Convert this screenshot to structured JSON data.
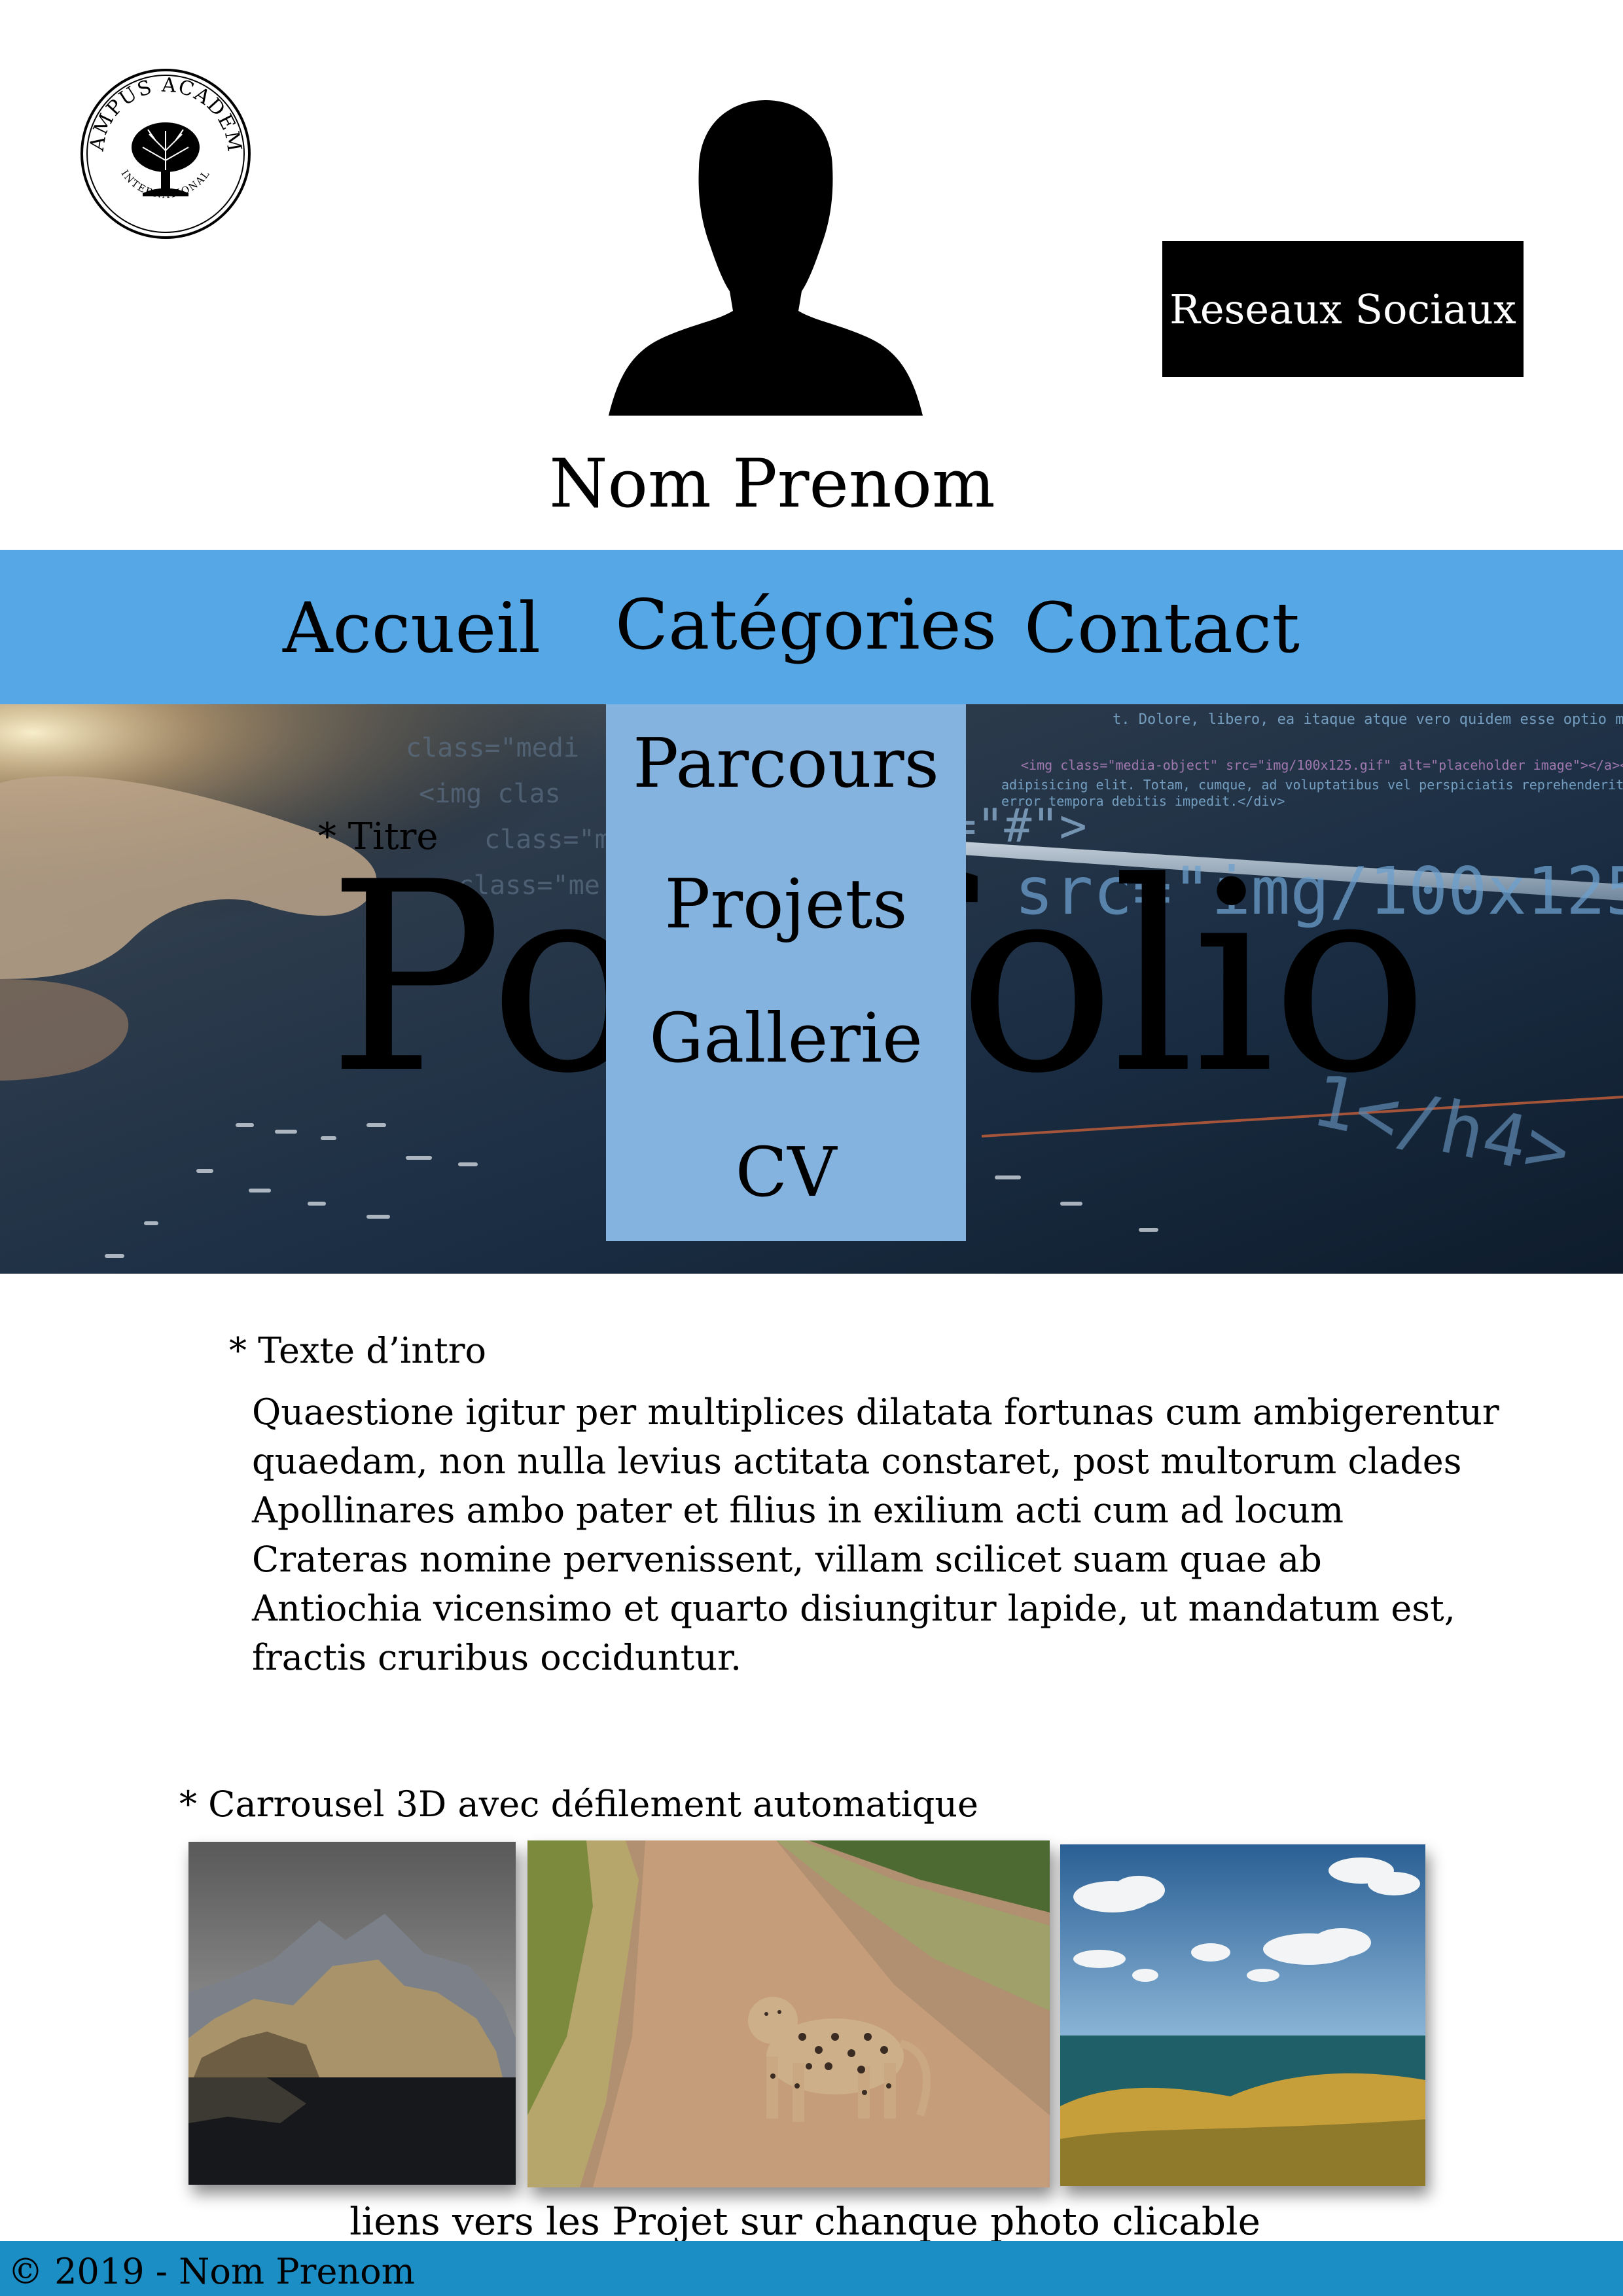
{
  "header": {
    "logo": {
      "text_top": "CAMPUS ACADEMY",
      "text_bottom": "INTERNATIONAL",
      "icon": "tree-icon"
    },
    "avatar_icon": "person-silhouette-icon",
    "name": "Nom Prenom",
    "social_button_label": "Reseaux Sociaux"
  },
  "nav": {
    "items": [
      {
        "label": "Accueil"
      },
      {
        "label": "Catégories"
      },
      {
        "label": "Contact"
      }
    ],
    "dropdown": [
      {
        "label": "Parcours"
      },
      {
        "label": "Projets"
      },
      {
        "label": "Gallerie"
      },
      {
        "label": "CV"
      }
    ],
    "color": "#55a7e6",
    "dropdown_color": "#84b3df"
  },
  "hero": {
    "title_label": "* Titre",
    "title": "Portfolio"
  },
  "intro": {
    "label": "* Texte d’intro",
    "lines": [
      "Quaestione igitur per multiplices dilatata fortunas cum ambigerentur",
      "quaedam, non nulla levius actitata constaret, post multorum clades",
      "Apollinares ambo pater et filius in exilium acti cum ad locum",
      "Crateras nomine pervenissent, villam scilicet suam quae ab",
      "Antiochia vicensimo et quarto disiungitur lapide, ut mandatum est,",
      "fractis cruribus occiduntur."
    ]
  },
  "carousel": {
    "label": "* Carrousel 3D avec défilement automatique",
    "photos": [
      {
        "subject": "coastal-cliffs-photo"
      },
      {
        "subject": "leopard-on-dirt-road-photo"
      },
      {
        "subject": "sea-and-sky-photo"
      }
    ],
    "caption": "liens vers les Projet sur chanque photo clicable"
  },
  "footer": {
    "text": "© 2019 - Nom Prenom",
    "color": "#1a8ec5"
  }
}
